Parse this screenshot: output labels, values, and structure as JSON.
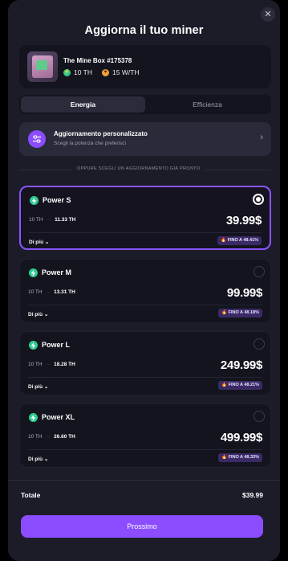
{
  "modal": {
    "title": "Aggiorna il tuo miner",
    "close_icon": "close-icon"
  },
  "product": {
    "name": "The Mine Box #175378",
    "hashrate": "10 TH",
    "efficiency": "15 W/TH"
  },
  "tabs": [
    {
      "label": "Energia",
      "active": true
    },
    {
      "label": "Efficienza",
      "active": false
    }
  ],
  "custom_upgrade": {
    "title": "Aggiornamento personalizzato",
    "subtitle": "Scegli la potenza che preferisci"
  },
  "divider_text": "OPPURE SCEGLI UN AGGIORNAMENTO GIÀ PRONTO",
  "plans": [
    {
      "name": "Power S",
      "from": "10 TH",
      "to": "11.33 TH",
      "price": "39.99$",
      "more": "Di più",
      "badge": "FINO A 48.41%",
      "selected": true
    },
    {
      "name": "Power M",
      "from": "10 TH",
      "to": "13.31 TH",
      "price": "99.99$",
      "more": "Di più",
      "badge": "FINO A 48.18%",
      "selected": false
    },
    {
      "name": "Power L",
      "from": "10 TH",
      "to": "18.28 TH",
      "price": "249.99$",
      "more": "Di più",
      "badge": "FINO A 48.21%",
      "selected": false
    },
    {
      "name": "Power XL",
      "from": "10 TH",
      "to": "26.60 TH",
      "price": "499.99$",
      "more": "Di più",
      "badge": "FINO A 48.33%",
      "selected": false
    }
  ],
  "summary": {
    "total_label": "Totale",
    "total_value": "$39.99"
  },
  "next_button": "Prossimo",
  "colors": {
    "accent": "#8b4dff",
    "success": "#2ecc8f",
    "background": "#1b1c28"
  }
}
